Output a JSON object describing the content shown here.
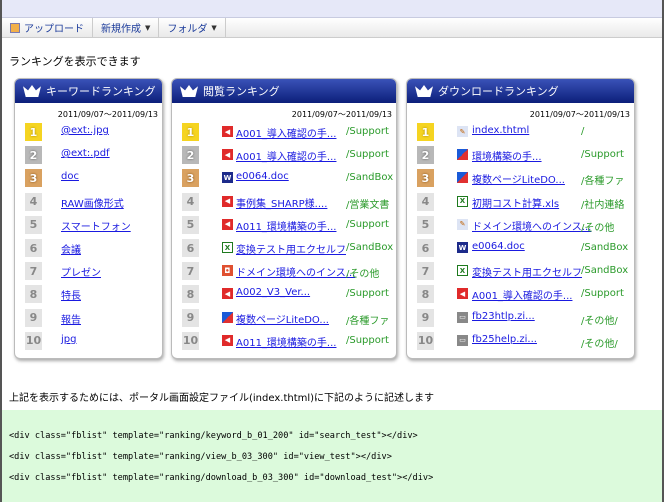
{
  "toolbar": {
    "upload": "アップロード",
    "new": "新規作成",
    "folder": "フォルダ"
  },
  "heading": "ランキングを表示できます",
  "panels": [
    {
      "id": "keyword",
      "title": "キーワードランキング",
      "date": "2011/09/07～2011/09/13",
      "items": [
        {
          "rank": "1",
          "label": "@ext:.jpg"
        },
        {
          "rank": "2",
          "label": "@ext:.pdf"
        },
        {
          "rank": "3",
          "label": "doc"
        },
        {
          "rank": "4",
          "label": "RAW画像形式"
        },
        {
          "rank": "5",
          "label": "スマートフォン"
        },
        {
          "rank": "6",
          "label": "会議"
        },
        {
          "rank": "7",
          "label": "プレゼン"
        },
        {
          "rank": "8",
          "label": "特長"
        },
        {
          "rank": "9",
          "label": "報告"
        },
        {
          "rank": "10",
          "label": "jpg"
        }
      ]
    },
    {
      "id": "view",
      "title": "閲覧ランキング",
      "date": "2011/09/07～2011/09/13",
      "items": [
        {
          "rank": "1",
          "icon": "pdf",
          "label": "A001_導入確認の手...",
          "path": "/Support"
        },
        {
          "rank": "2",
          "icon": "pdf",
          "label": "A001_導入確認の手...",
          "path": "/Support"
        },
        {
          "rank": "3",
          "icon": "doc",
          "label": "e0064.doc",
          "path": "/SandBox"
        },
        {
          "rank": "4",
          "icon": "pdf",
          "label": "事例集_SHARP様....",
          "path": "/営業文書"
        },
        {
          "rank": "5",
          "icon": "pdf",
          "label": "A011_環境構築の手...",
          "path": "/Support"
        },
        {
          "rank": "6",
          "icon": "xls",
          "label": "変換テスト用エクセルフ",
          "path": "/SandBox"
        },
        {
          "rank": "7",
          "icon": "ppt",
          "label": "ドメイン環境へのインス...",
          "path": "/その他"
        },
        {
          "rank": "8",
          "icon": "pdf",
          "label": "A002_V3_Ver...",
          "path": "/Support"
        },
        {
          "rank": "9",
          "icon": "img",
          "label": "複数ページLiteDO...",
          "path": "/各種ファ"
        },
        {
          "rank": "10",
          "icon": "pdf",
          "label": "A011_環境構築の手...",
          "path": "/Support"
        }
      ]
    },
    {
      "id": "download",
      "title": "ダウンロードランキング",
      "date": "2011/09/07～2011/09/13",
      "items": [
        {
          "rank": "1",
          "icon": "html",
          "label": "index.thtml",
          "path": "/"
        },
        {
          "rank": "2",
          "icon": "img",
          "label": "環境構築の手...",
          "path": "/Support"
        },
        {
          "rank": "3",
          "icon": "img",
          "label": "複数ページLiteDO...",
          "path": "/各種ファ"
        },
        {
          "rank": "4",
          "icon": "xls",
          "label": "初期コスト計算.xls",
          "path": "/社内連絡"
        },
        {
          "rank": "5",
          "icon": "html",
          "label": "ドメイン環境へのインス...",
          "path": "/その他"
        },
        {
          "rank": "6",
          "icon": "doc",
          "label": "e0064.doc",
          "path": "/SandBox"
        },
        {
          "rank": "7",
          "icon": "xls",
          "label": "変換テスト用エクセルフ",
          "path": "/SandBox"
        },
        {
          "rank": "8",
          "icon": "pdf",
          "label": "A001_導入確認の手...",
          "path": "/Support"
        },
        {
          "rank": "9",
          "icon": "zip",
          "label": "fb23htlp.zi...",
          "path": "/その他/"
        },
        {
          "rank": "10",
          "icon": "zip",
          "label": "fb25help.zi...",
          "path": "/その他/"
        }
      ]
    }
  ],
  "description": "上記を表示するためには、ポータル画面設定ファイル(index.thtml)に下記のように記述します",
  "code": [
    "<div class=\"fblist\" template=\"ranking/keyword_b_01_200\" id=\"search_test\"></div>",
    "<div class=\"fblist\" template=\"ranking/view_b_03_300\" id=\"view_test\"></div>",
    "<div class=\"fblist\" template=\"ranking/download_b_03_300\" id=\"download_test\"></div>"
  ]
}
